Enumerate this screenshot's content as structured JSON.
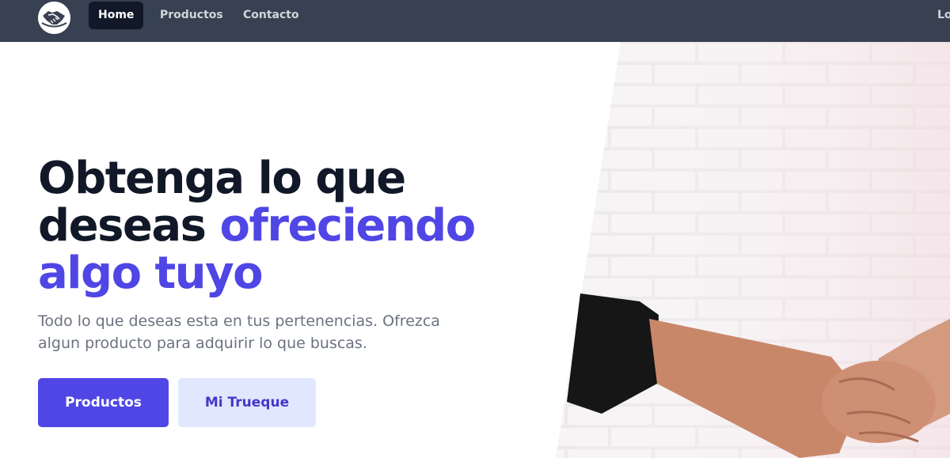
{
  "nav": {
    "links": [
      {
        "label": "Home",
        "active": true
      },
      {
        "label": "Productos",
        "active": false
      },
      {
        "label": "Contacto",
        "active": false
      }
    ],
    "right_label": "Lo"
  },
  "hero": {
    "headline_part1": "Obtenga lo que",
    "headline_part2": "deseas",
    "headline_accent1": "ofreciendo",
    "headline_accent2": "algo tuyo",
    "subtitle": "Todo lo que deseas esta en tus pertenencias. Ofrezca algun producto para adquirir lo que buscas.",
    "primary_button": "Productos",
    "secondary_button": "Mi Trueque"
  },
  "colors": {
    "nav_bg": "#374151",
    "accent": "#4f46e5",
    "secondary_bg": "#e0e7ff",
    "text_dark": "#111827",
    "text_muted": "#6b7280"
  },
  "icons": {
    "logo": "handshake-logo-icon"
  }
}
